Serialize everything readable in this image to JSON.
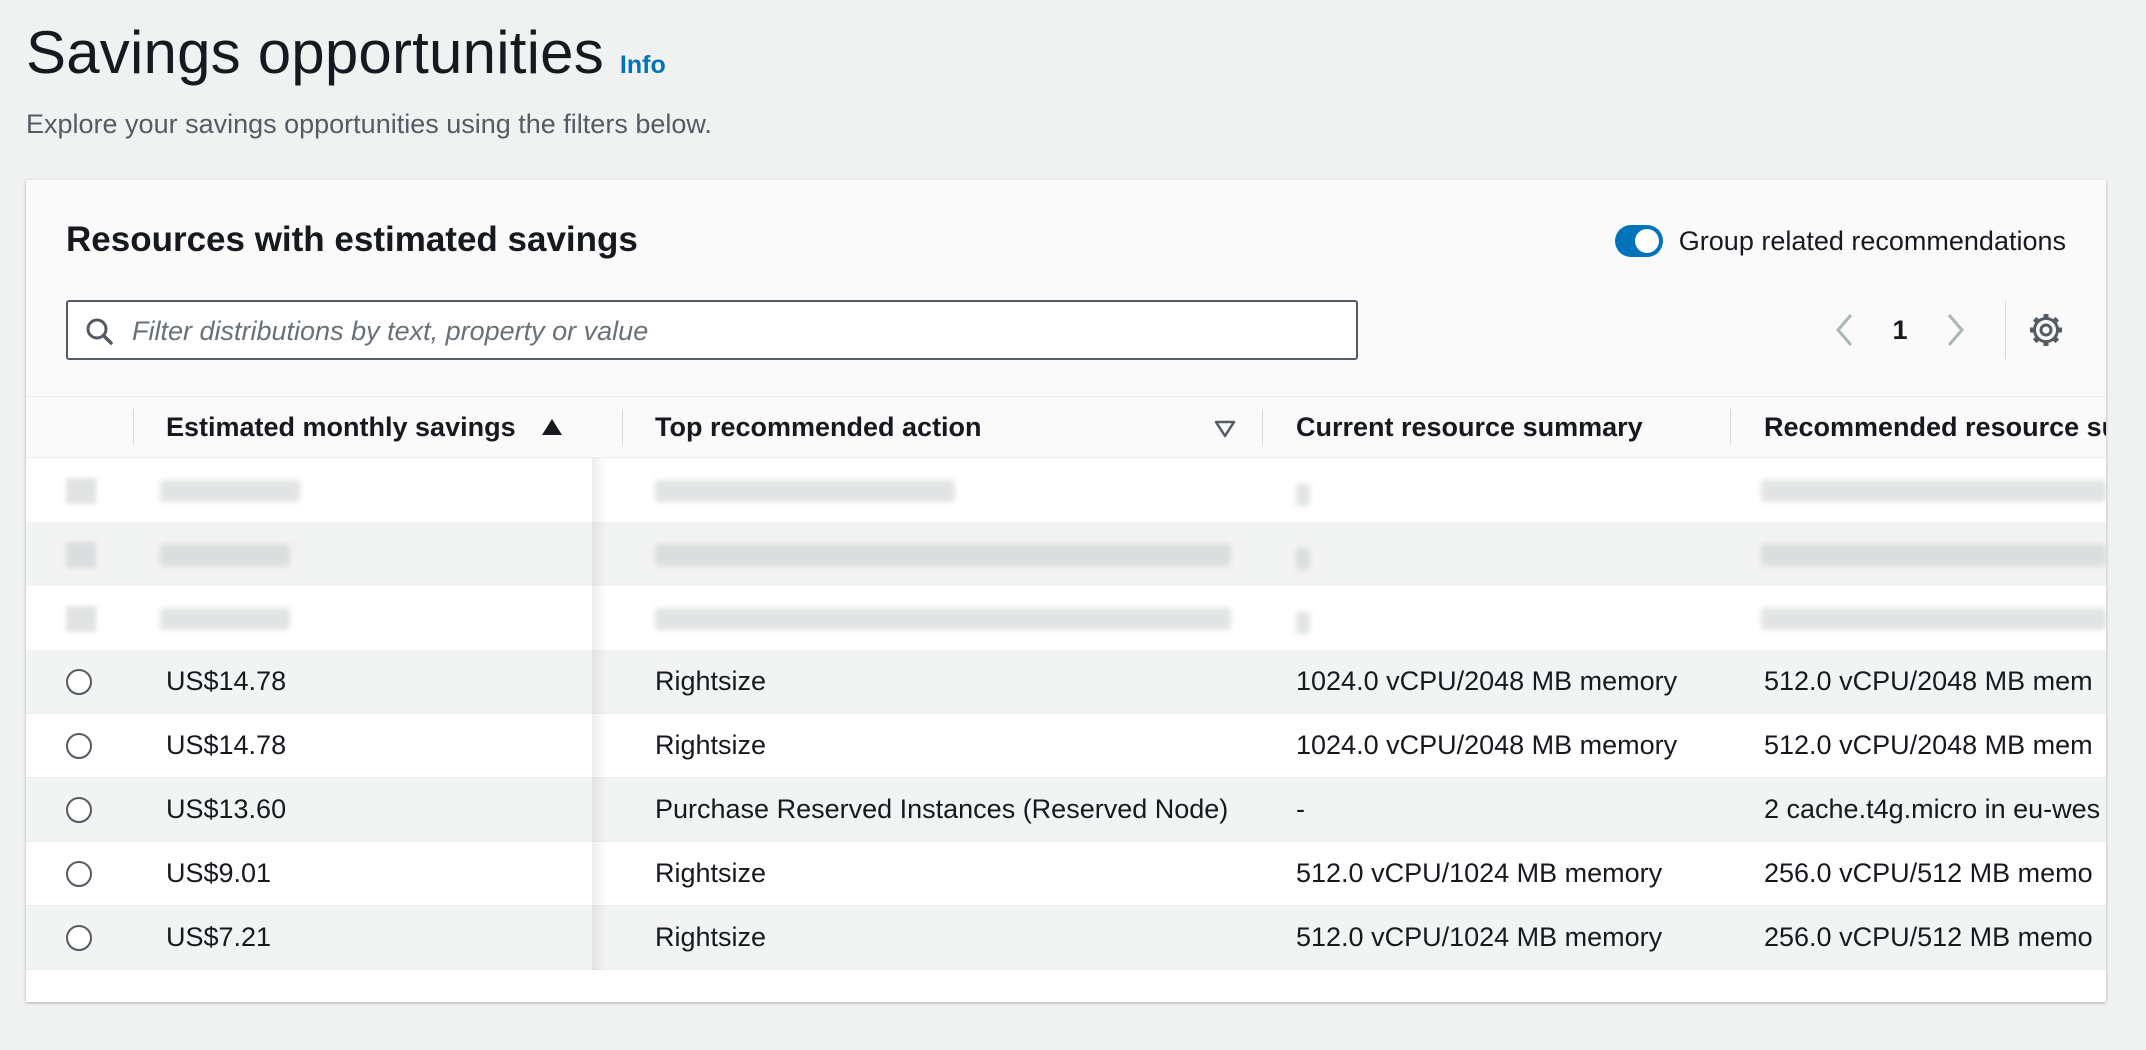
{
  "page": {
    "title": "Savings opportunities",
    "info_link": "Info",
    "description": "Explore your savings opportunities using the filters below."
  },
  "panel": {
    "title": "Resources with estimated savings",
    "toggle": {
      "label": "Group related recommendations",
      "on": true
    },
    "search": {
      "placeholder": "Filter distributions by text, property or value",
      "value": ""
    },
    "pagination": {
      "current_page": "1"
    }
  },
  "table": {
    "columns": [
      {
        "label": "Estimated monthly savings",
        "sort": "ascending"
      },
      {
        "label": "Top recommended action",
        "filter": true
      },
      {
        "label": "Current resource summary"
      },
      {
        "label": "Recommended resource su"
      }
    ],
    "rows": [
      {
        "savings": "US$14.78",
        "action": "Rightsize",
        "current": "1024.0 vCPU/2048 MB memory",
        "recommended": "512.0 vCPU/2048 MB mem"
      },
      {
        "savings": "US$14.78",
        "action": "Rightsize",
        "current": "1024.0 vCPU/2048 MB memory",
        "recommended": "512.0 vCPU/2048 MB mem"
      },
      {
        "savings": "US$13.60",
        "action": "Purchase Reserved Instances (Reserved Node)",
        "current": "-",
        "recommended": "2 cache.t4g.micro in eu-wes"
      },
      {
        "savings": "US$9.01",
        "action": "Rightsize",
        "current": "512.0 vCPU/1024 MB memory",
        "recommended": "256.0 vCPU/512 MB memo"
      },
      {
        "savings": "US$7.21",
        "action": "Rightsize",
        "current": "512.0 vCPU/1024 MB memory",
        "recommended": "256.0 vCPU/512 MB memo"
      }
    ]
  },
  "colors": {
    "accent": "#0073bb",
    "text": "#16191f",
    "muted": "#545b64",
    "background": "#f0f2f2"
  },
  "icons": [
    "search-icon",
    "sort-ascending-icon",
    "filter-icon",
    "chevron-left-icon",
    "chevron-right-icon",
    "gear-icon"
  ]
}
